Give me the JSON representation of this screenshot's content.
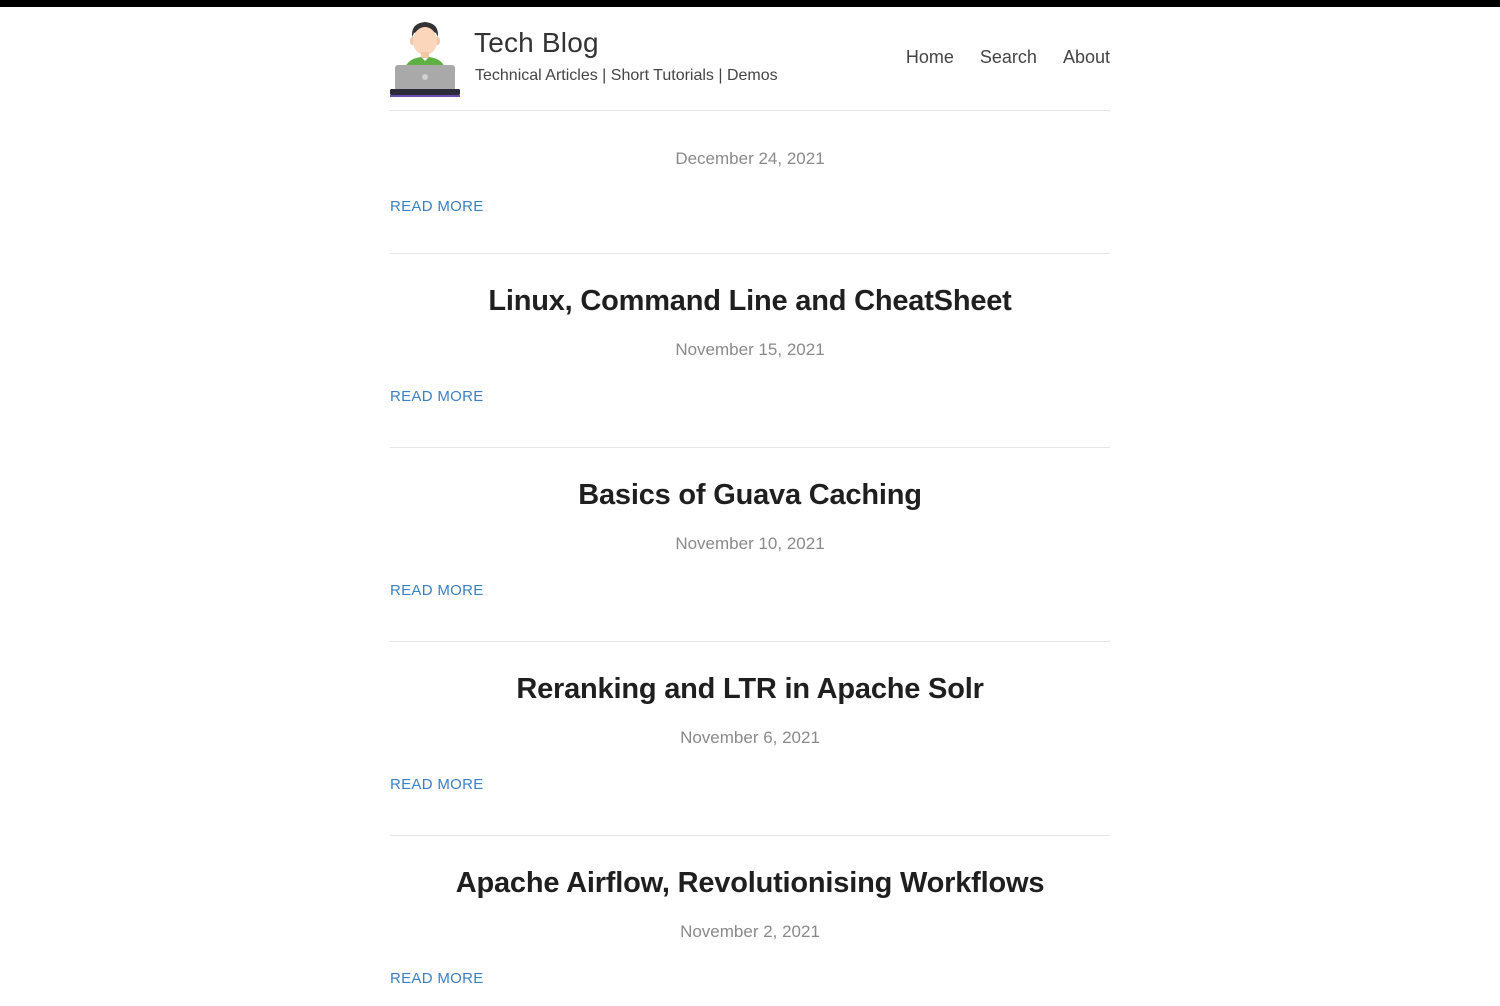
{
  "site": {
    "title": "Tech Blog",
    "tagline": "Technical Articles | Short Tutorials | Demos",
    "avatar_icon": "developer-with-laptop-icon"
  },
  "nav": {
    "items": [
      {
        "label": "Home"
      },
      {
        "label": "Search"
      },
      {
        "label": "About"
      }
    ]
  },
  "posts": [
    {
      "title": "",
      "date": "December 24, 2021",
      "read_more": "READ MORE"
    },
    {
      "title": "Linux, Command Line and CheatSheet",
      "date": "November 15, 2021",
      "read_more": "READ MORE"
    },
    {
      "title": "Basics of Guava Caching",
      "date": "November 10, 2021",
      "read_more": "READ MORE"
    },
    {
      "title": "Reranking and LTR in Apache Solr",
      "date": "November 6, 2021",
      "read_more": "READ MORE"
    },
    {
      "title": "Apache Airflow, Revolutionising Workflows",
      "date": "November 2, 2021",
      "read_more": "READ MORE"
    }
  ],
  "colors": {
    "link": "#3b7fc4",
    "date": "#8a8a8a",
    "title": "#1f1f1f",
    "divider": "#e6e6e6"
  }
}
